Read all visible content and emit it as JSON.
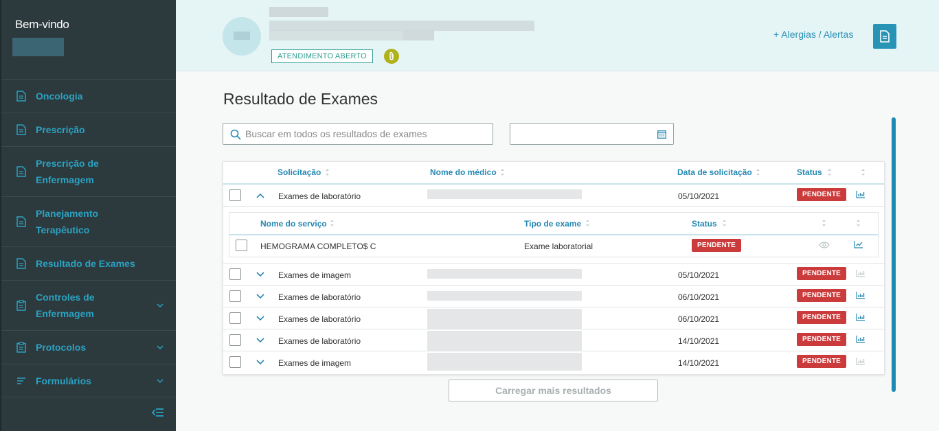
{
  "sidebar": {
    "welcome": "Bem-vindo",
    "items": [
      {
        "label": "Oncologia",
        "icon": "document-icon"
      },
      {
        "label": "Prescrição",
        "icon": "document-icon"
      },
      {
        "label": "Prescrição de Enfermagem",
        "icon": "document-icon"
      },
      {
        "label": "Planejamento Terapêutico",
        "icon": "document-icon"
      },
      {
        "label": "Resultado de Exames",
        "icon": "document-icon"
      },
      {
        "label": "Controles de Enfermagem",
        "icon": "clipboard-icon",
        "expandable": true
      },
      {
        "label": "Protocolos",
        "icon": "clipboard-icon",
        "expandable": true
      },
      {
        "label": "Formulários",
        "icon": "form-lines-icon",
        "expandable": true
      }
    ]
  },
  "header": {
    "status_badge": "ATENDIMENTO ABERTO",
    "alerts_link": "+ Alergias / Alertas"
  },
  "main": {
    "title": "Resultado de Exames",
    "search_placeholder": "Buscar em todos os resultados de exames",
    "date_value": "",
    "load_more": "Carregar mais resultados"
  },
  "table": {
    "columns": [
      "Solicitação",
      "Nome do médico",
      "Data de solicitação",
      "Status"
    ],
    "rows": [
      {
        "solicitacao": "Exames de laboratório",
        "data": "05/10/2021",
        "status": "PENDENTE",
        "expanded": true,
        "chart_active": true
      },
      {
        "solicitacao": "Exames de imagem",
        "data": "05/10/2021",
        "status": "PENDENTE",
        "expanded": false,
        "chart_active": false
      },
      {
        "solicitacao": "Exames de laboratório",
        "data": "06/10/2021",
        "status": "PENDENTE",
        "expanded": false,
        "chart_active": true
      },
      {
        "solicitacao": "Exames de laboratório",
        "data": "06/10/2021",
        "status": "PENDENTE",
        "expanded": false,
        "chart_active": true
      },
      {
        "solicitacao": "Exames de laboratório",
        "data": "14/10/2021",
        "status": "PENDENTE",
        "expanded": false,
        "chart_active": true
      },
      {
        "solicitacao": "Exames de imagem",
        "data": "14/10/2021",
        "status": "PENDENTE",
        "expanded": false,
        "chart_active": false
      }
    ],
    "sub_table": {
      "columns": [
        "Nome do serviço",
        "Tipo de exame",
        "Status"
      ],
      "rows": [
        {
          "servico": "HEMOGRAMA COMPLETO$ C",
          "tipo": "Exame laboratorial",
          "status": "PENDENTE"
        }
      ]
    }
  },
  "colors": {
    "sidebar_bg": "#2c393d",
    "accent": "#2ba3c2",
    "header_bg": "#e5f5f6",
    "pending": "#cc3b3b",
    "open_badge": "#2a9d8f"
  }
}
